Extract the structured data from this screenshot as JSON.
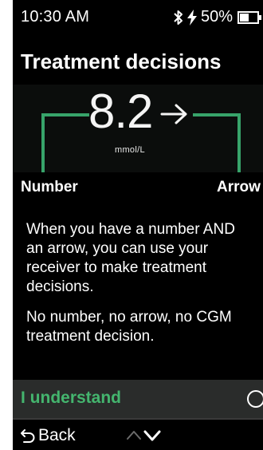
{
  "status_bar": {
    "time": "10:30 AM",
    "battery": "50%",
    "icons": [
      "bluetooth-icon",
      "charging-bolt-icon",
      "battery-icon"
    ]
  },
  "screen": {
    "title": "Treatment decisions"
  },
  "illustration": {
    "reading_value": "8.2",
    "trend_arrow": "right-arrow-icon",
    "unit": "mmol/L",
    "label_left": "Number",
    "label_right": "Arrow"
  },
  "body": {
    "paragraph_1": "When you have a number AND an arrow, you can use your receiver to make treatment decisions.",
    "paragraph_2": "No number, no arrow, no CGM treatment decision."
  },
  "confirm": {
    "label": "I understand",
    "checked": false
  },
  "nav": {
    "back_label": "Back",
    "icons": [
      "back-arrow-icon",
      "chevron-up-icon",
      "chevron-down-icon"
    ]
  },
  "colors": {
    "accent_green": "#44b56e",
    "bracket_green": "#37a36a",
    "background": "#000000",
    "row_highlight": "#2a2c2b"
  }
}
